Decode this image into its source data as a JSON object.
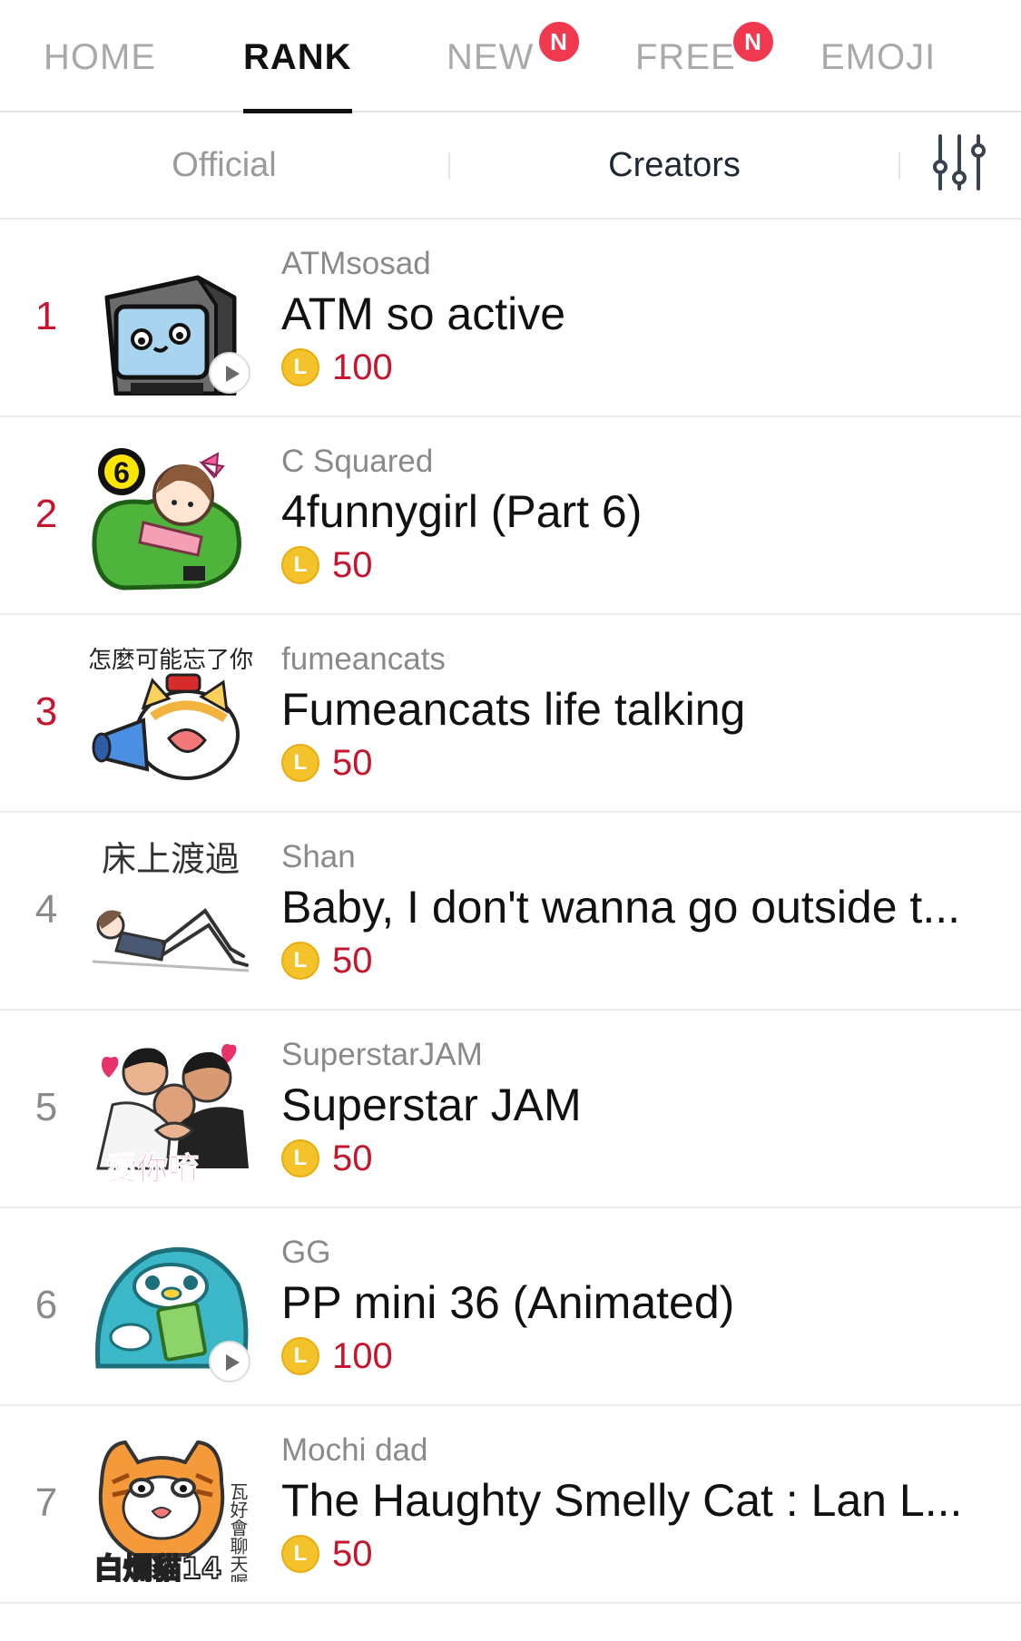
{
  "top_tabs": [
    {
      "label": "HOME",
      "active": false,
      "badge": ""
    },
    {
      "label": "RANK",
      "active": true,
      "badge": ""
    },
    {
      "label": "NEW",
      "active": false,
      "badge": "N"
    },
    {
      "label": "FREE",
      "active": false,
      "badge": "N"
    },
    {
      "label": "EMOJI",
      "active": false,
      "badge": ""
    }
  ],
  "sub_tabs": [
    {
      "label": "Official",
      "active": false
    },
    {
      "label": "Creators",
      "active": true
    }
  ],
  "filter_icon": "sliders-icon",
  "coin_icon_letter": "L",
  "colors": {
    "accent_red": "#c4172f",
    "badge_red": "#f0384f",
    "coin_yellow": "#f4c22b"
  },
  "items": [
    {
      "rank": "1",
      "creator": "ATMsosad",
      "title": "ATM so active",
      "price": "100",
      "animated": true
    },
    {
      "rank": "2",
      "creator": "C Squared",
      "title": "4funnygirl (Part 6)",
      "price": "50",
      "animated": false
    },
    {
      "rank": "3",
      "creator": "fumeancats",
      "title": "Fumeancats life talking",
      "price": "50",
      "animated": false,
      "thumb_text": "怎麼可能忘了你"
    },
    {
      "rank": "4",
      "creator": "Shan",
      "title": "Baby, I don't wanna go outside t...",
      "price": "50",
      "animated": false,
      "thumb_text": "床上渡過"
    },
    {
      "rank": "5",
      "creator": "SuperstarJAM",
      "title": "Superstar JAM",
      "price": "50",
      "animated": false,
      "thumb_text": "愛你唷"
    },
    {
      "rank": "6",
      "creator": "GG",
      "title": "PP mini 36 (Animated)",
      "price": "100",
      "animated": true
    },
    {
      "rank": "7",
      "creator": "Mochi dad",
      "title": "The Haughty Smelly Cat : Lan L...",
      "price": "50",
      "animated": false,
      "thumb_text": "白爛貓14",
      "thumb_side_text": "瓦好會聊天喔"
    }
  ]
}
